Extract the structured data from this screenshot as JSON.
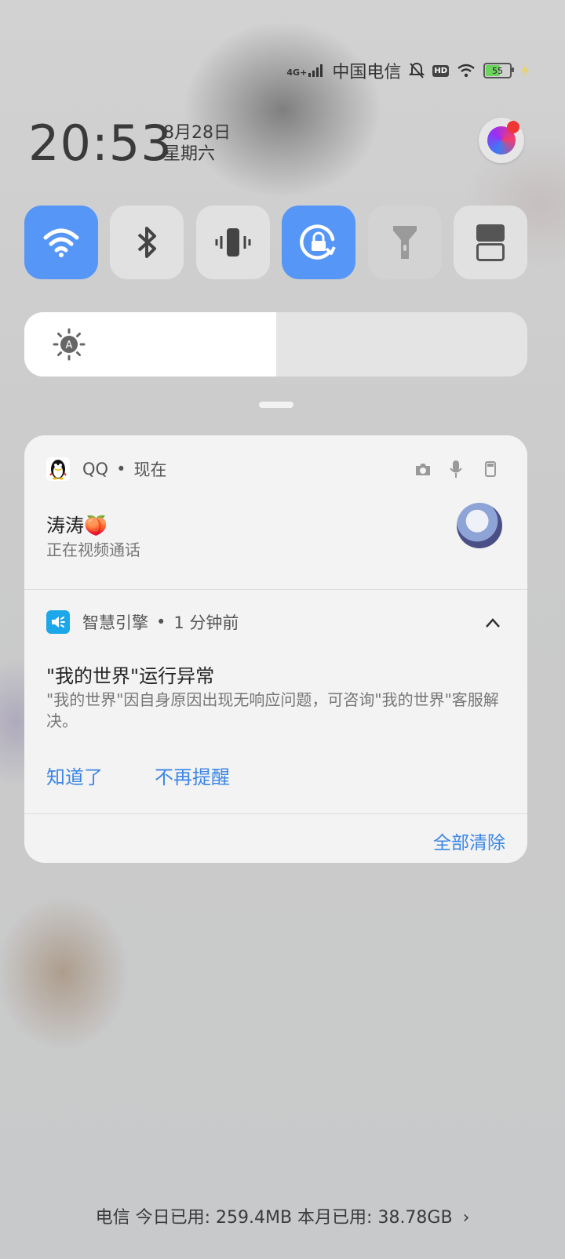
{
  "status_bar": {
    "network_type": "4G+",
    "carrier": "中国电信",
    "hd_badge": "HD",
    "battery": "55",
    "icons": [
      "signal-icon",
      "mute-bell-icon",
      "hd-icon",
      "wifi-icon",
      "battery-icon",
      "charging-icon"
    ]
  },
  "clock": {
    "time": "20:53",
    "date": "8月28日",
    "weekday": "星期六"
  },
  "quick_toggles": [
    {
      "name": "wifi",
      "icon": "wifi-icon",
      "active": true
    },
    {
      "name": "bluetooth",
      "icon": "bluetooth-icon",
      "active": false
    },
    {
      "name": "vibrate",
      "icon": "vibrate-icon",
      "active": false
    },
    {
      "name": "rotation-lock",
      "icon": "rotation-lock-icon",
      "active": true
    },
    {
      "name": "flashlight",
      "icon": "flashlight-icon",
      "active": false
    },
    {
      "name": "screen-record",
      "icon": "split-screen-icon",
      "active": false
    }
  ],
  "brightness": {
    "level": 0.5,
    "auto_icon": "A"
  },
  "notifications": {
    "qq": {
      "app": "QQ",
      "separator": "•",
      "when": "现在",
      "sender": "涛涛🍑",
      "message": "正在视频通话"
    },
    "engine": {
      "app": "智慧引擎",
      "separator": "•",
      "when": "1 分钟前",
      "title": "\"我的世界\"运行异常",
      "body": "\"我的世界\"因自身原因出现无响应问题，可咨询\"我的世界\"客服解决。",
      "action_ok": "知道了",
      "action_mute": "不再提醒"
    },
    "clear_all": "全部清除"
  },
  "data_usage": "电信 今日已用: 259.4MB 本月已用: 38.78GB"
}
